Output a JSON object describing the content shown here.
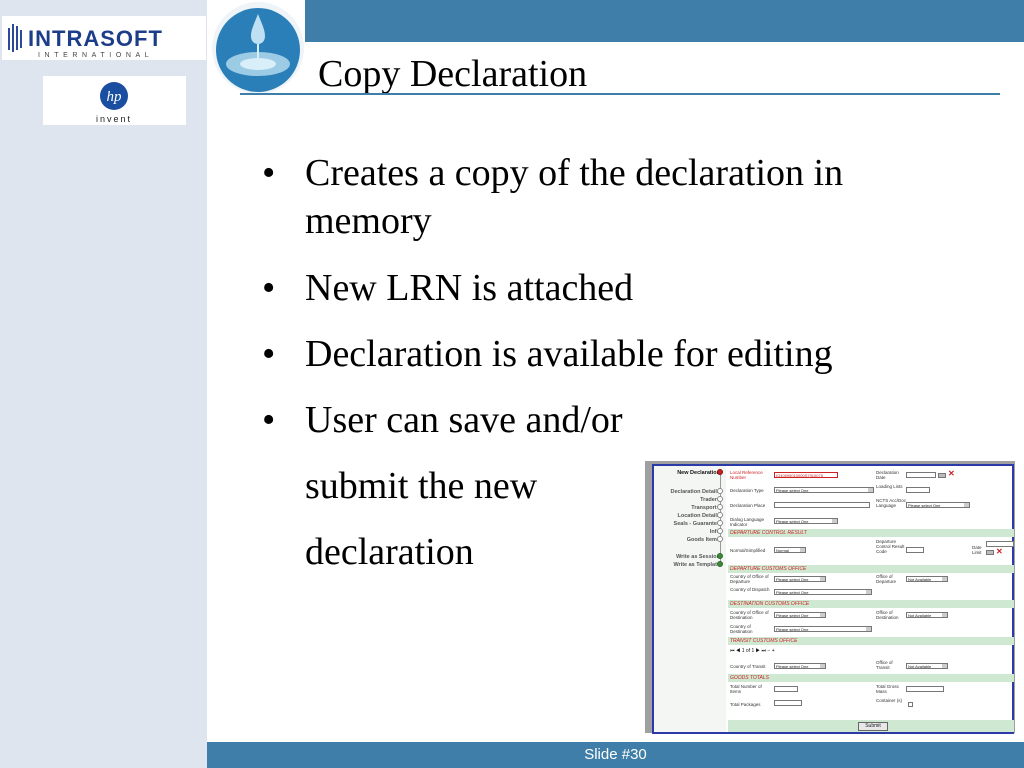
{
  "logos": {
    "intrasoft": "INTRASOFT",
    "intrasoft_sub": "INTERNATIONAL",
    "hp_mark": "hp",
    "hp_tagline": "invent"
  },
  "title": "Copy Declaration",
  "bullets": [
    "Creates a copy of the declaration in",
    "memory",
    "New LRN is attached",
    "Declaration is available for editing",
    "User can save and/or",
    "submit the new",
    "declaration"
  ],
  "footer": {
    "slide_label": "Slide #30"
  },
  "screenshot": {
    "nav": {
      "items": [
        "New Declaration",
        "Declaration Details",
        "Traders",
        "Transport -",
        "Location Details",
        "Seals - Guarantee",
        "Info",
        "Goods Items",
        "Write as Session",
        "Write as Template"
      ]
    },
    "fields": {
      "lrn_label": "Local Reference Number",
      "lrn_value": "IG40595010000S7910075",
      "decl_date_label": "Declaration Date",
      "decl_type_label": "Declaration Type",
      "loading_lists_label": "Loading Lists",
      "decl_place_label": "Declaration Place",
      "ncts_lang_label": "NCTS Acc/Doc Language",
      "dialog_lang_label": "Dialog Language Indicator",
      "normal_simplified_label": "Normal/Simplified",
      "normal_value": "Normal",
      "dep_control_label": "Departure Control Result Code",
      "date_limit_label": "Date Limit",
      "country_office_dep_label": "Country of Office of Departure",
      "office_dep_label": "Office of Departure",
      "country_dispatch_label": "Country of Dispatch",
      "country_office_dest_label": "Country of Office of Destination",
      "office_dest_label": "Office of Destination",
      "country_dest_label": "Country of Destination",
      "country_transit_label": "Country of Transit",
      "office_transit_label": "Office of Transit",
      "total_items_label": "Total Number of Items",
      "total_gross_label": "Total Gross Mass",
      "total_packages_label": "Total Packages",
      "container_label": "Container (s)",
      "select_one": "Please select One",
      "not_available": "Not Available"
    },
    "sections": {
      "dep_control": "DEPARTURE CONTROL RESULT",
      "dep_office": "DEPARTURE CUSTOMS OFFICE",
      "dest_office": "DESTINATION CUSTOMS OFFICE",
      "transit_office": "TRANSIT CUSTOMS OFFICE",
      "goods_totals": "GOODS TOTALS"
    },
    "pager": "1 of 1",
    "submit_label": "Submit"
  },
  "colors": {
    "theme_blue": "#3f7ea8",
    "left_panel": "#dfe5ee",
    "screenshot_border": "#2a3aa8",
    "section_green": "#cfe8d2",
    "alert_red": "#cc2222"
  }
}
